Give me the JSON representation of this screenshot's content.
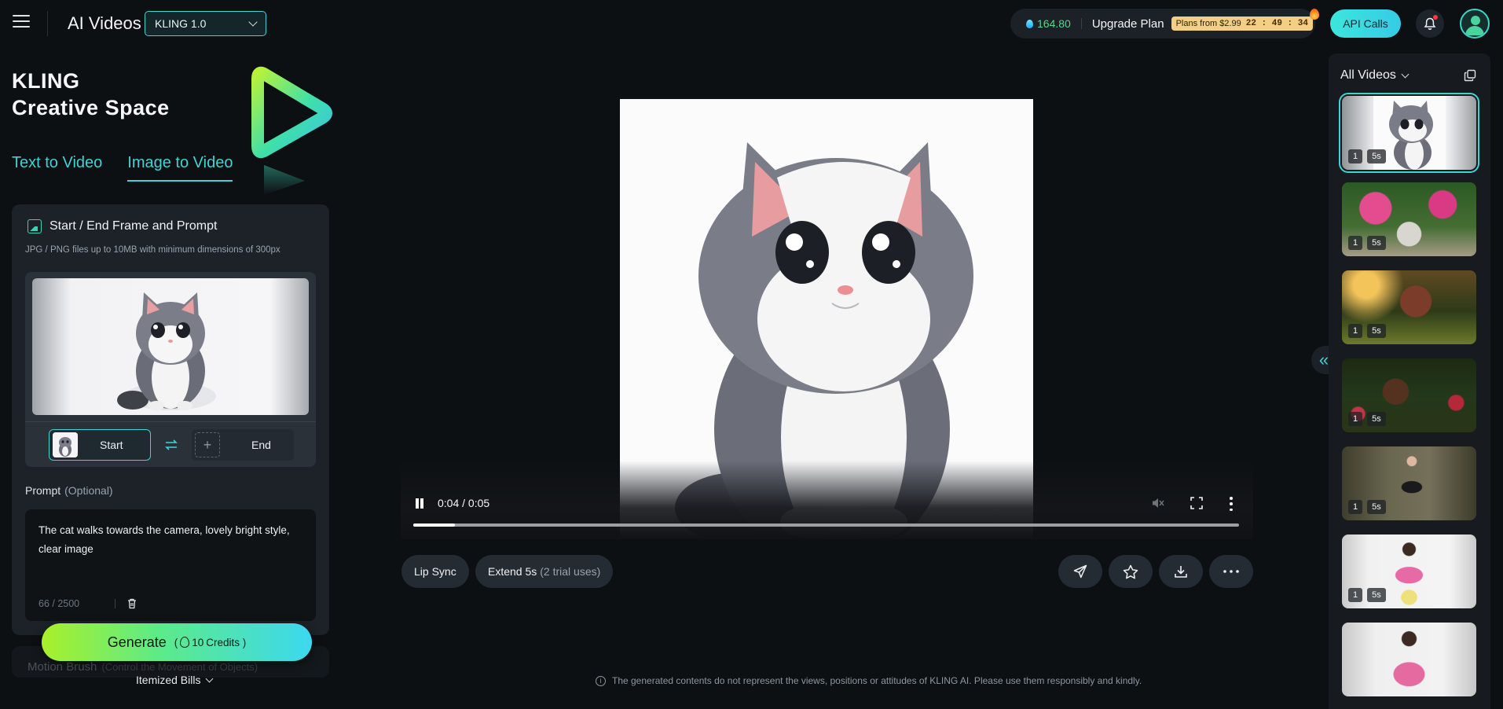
{
  "header": {
    "app_title": "AI Videos",
    "model_select": "KLING 1.0",
    "credits": "164.80",
    "upgrade_label": "Upgrade Plan",
    "plans_text": "Plans from $2.99",
    "countdown": "22 : 49 : 34",
    "api_button": "API Calls"
  },
  "left": {
    "brand_line1": "KLING",
    "brand_line2": "Creative Space",
    "tabs": [
      "Text to Video",
      "Image to Video"
    ],
    "active_tab": "Image to Video",
    "frame_card": {
      "title": "Start / End Frame and Prompt",
      "hint": "JPG / PNG files up to 10MB with minimum dimensions of 300px",
      "start_label": "Start",
      "end_label": "End"
    },
    "prompt": {
      "label": "Prompt",
      "optional": "(Optional)",
      "text": "The cat walks towards the camera, lovely bright style, clear image",
      "count": "66 / 2500"
    },
    "motion_brush": {
      "label": "Motion Brush",
      "sub": "(Control the Movement of Objects)"
    },
    "generate": {
      "label": "Generate",
      "credits_open": "(",
      "credits": "10",
      "credits_unit": "Credits )"
    },
    "itemized_bills": "Itemized Bills"
  },
  "player": {
    "time": "0:04 / 0:05",
    "progress": 0.05,
    "state": "playing"
  },
  "actions": {
    "lip_sync": "Lip Sync",
    "extend": "Extend 5s",
    "extend_trial": "(2 trial uses)"
  },
  "disclaimer": "The generated contents do not represent the views, positions or attitudes of KLING AI. Please use them responsibly and kindly.",
  "gallery": {
    "title": "All Videos",
    "items": [
      {
        "count": "1",
        "duration": "5s",
        "selected": true
      },
      {
        "count": "1",
        "duration": "5s"
      },
      {
        "count": "1",
        "duration": "5s"
      },
      {
        "count": "1",
        "duration": "5s"
      },
      {
        "count": "1",
        "duration": "5s"
      },
      {
        "count": "1",
        "duration": "5s"
      },
      {
        "count": "",
        "duration": ""
      }
    ]
  },
  "colors": {
    "accent": "#3fd3d3",
    "background": "#0d1013",
    "credit_green": "#52d98b",
    "plans_badge": "#f2cf82"
  }
}
